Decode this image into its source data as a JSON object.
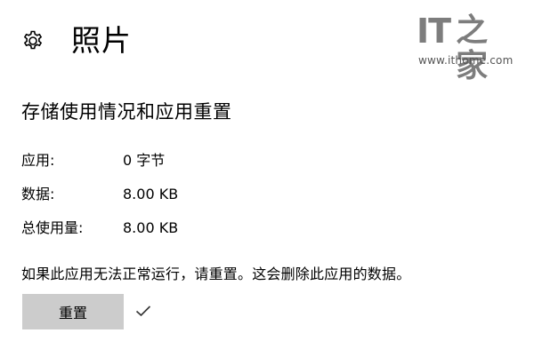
{
  "header": {
    "icon": "gear-icon",
    "title": "照片"
  },
  "watermark": {
    "logo_text": "IT",
    "logo_char": "之家",
    "url": "www.ithome.com"
  },
  "section": {
    "title": "存储使用情况和应用重置"
  },
  "stats": [
    {
      "label": "应用:",
      "value": "0 字节"
    },
    {
      "label": "数据:",
      "value": "8.00 KB"
    },
    {
      "label": "总使用量:",
      "value": "8.00 KB"
    }
  ],
  "reset": {
    "description": "如果此应用无法正常运行，请重置。这会删除此应用的数据。",
    "button_label": "重置",
    "status_icon": "checkmark-icon"
  },
  "colors": {
    "button_bg": "#cccccc",
    "watermark_gray": "#7d7d7d"
  }
}
